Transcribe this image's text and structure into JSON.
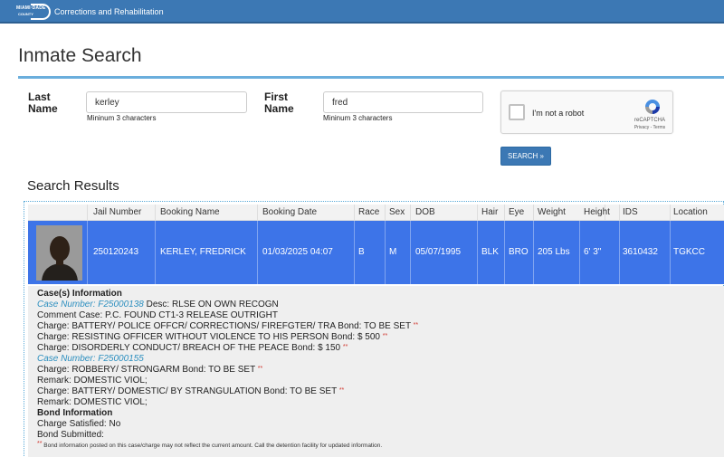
{
  "header": {
    "logo_text_1": "MIAMI·DADE",
    "logo_text_2": "COUNTY",
    "app_title": "Corrections and Rehabilitation"
  },
  "page": {
    "title": "Inmate Search"
  },
  "form": {
    "last_name": {
      "label_1": "Last",
      "label_2": "Name",
      "value": "kerley",
      "hint": "Mininum 3 characters"
    },
    "first_name": {
      "label_1": "First",
      "label_2": "Name",
      "value": "fred",
      "hint": "Mininum 3 characters"
    },
    "captcha": {
      "text": "I'm not a robot",
      "brand": "reCAPTCHA",
      "terms": "Privacy - Terms"
    },
    "search_button": "SEARCH »"
  },
  "results": {
    "title": "Search Results",
    "columns": [
      "Jail Number",
      "Booking Name",
      "Booking Date",
      "Race",
      "Sex",
      "DOB",
      "Hair",
      "Eye",
      "Weight",
      "Height",
      "IDS",
      "Location"
    ],
    "row": {
      "jail_number": "250120243",
      "booking_name": "KERLEY, FREDRICK",
      "booking_date": "01/03/2025 04:07",
      "race": "B",
      "sex": "M",
      "dob": "05/07/1995",
      "hair": "BLK",
      "eye": "BRO",
      "weight": "205 Lbs",
      "height": "6' 3\"",
      "ids": "3610432",
      "location": "TGKCC"
    },
    "details": {
      "cases_heading": "Case(s) Information",
      "case1_number": "Case Number: F25000138",
      "case1_desc": " Desc: RLSE ON OWN RECOGN",
      "case1_comment": "Comment Case: P.C. FOUND CT1-3 RELEASE OUTRIGHT",
      "case1_charge1": "Charge: BATTERY/ POLICE OFFCR/ CORRECTIONS/ FIREFGTER/ TRA Bond: TO BE SET ",
      "case1_charge2": "Charge: RESISTING OFFICER WITHOUT VIOLENCE TO HIS PERSON Bond: $ 500 ",
      "case1_charge3": "Charge: DISORDERLY CONDUCT/ BREACH OF THE PEACE Bond: $ 150 ",
      "case2_number": "Case Number: F25000155",
      "case2_charge1": "Charge: ROBBERY/ STRONGARM Bond: TO BE SET ",
      "case2_remark1": "Remark: DOMESTIC VIOL;",
      "case2_charge2": "Charge: BATTERY/ DOMESTIC/ BY STRANGULATION Bond: TO BE SET ",
      "case2_remark2": "Remark: DOMESTIC VIOL;",
      "bond_heading": "Bond Information",
      "charge_satisfied": "Charge Satisfied: No",
      "bond_submitted": "Bond Submitted:",
      "star": "**",
      "footnote": " Bond information posted on this case/charge may not reflect the current amount. Call the detention facility for updated information."
    }
  },
  "colors": {
    "header": "#3c78b4",
    "selected_row": "#3d74e8",
    "title_rule": "#6aaedc",
    "case_link": "#2d8fbf",
    "star": "#d0352c"
  }
}
